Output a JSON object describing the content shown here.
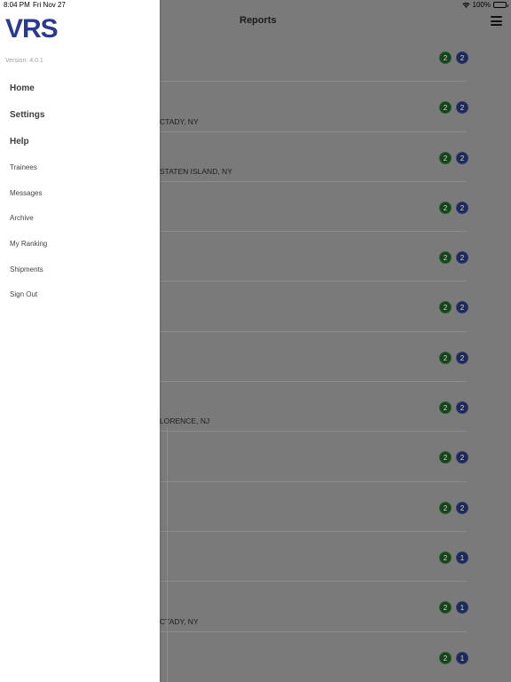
{
  "status_bar": {
    "time": "8:04 PM",
    "date": "Fri Nov 27",
    "battery": "100%",
    "icons": [
      "wifi-icon",
      "battery-icon"
    ]
  },
  "reports": {
    "title": "Reports",
    "menu_icon": "hamburger-menu-icon",
    "rows": [
      {
        "subtitle": "",
        "badge_green": "2",
        "badge_blue": "2"
      },
      {
        "subtitle": "CTADY, NY",
        "badge_green": "2",
        "badge_blue": "2"
      },
      {
        "subtitle": "STATEN ISLAND, NY",
        "badge_green": "2",
        "badge_blue": "2"
      },
      {
        "subtitle": "",
        "badge_green": "2",
        "badge_blue": "2"
      },
      {
        "subtitle": "",
        "badge_green": "2",
        "badge_blue": "2"
      },
      {
        "subtitle": "",
        "badge_green": "2",
        "badge_blue": "2"
      },
      {
        "subtitle": "",
        "badge_green": "2",
        "badge_blue": "2"
      },
      {
        "subtitle": "LORENCE, NJ",
        "badge_green": "2",
        "badge_blue": "2"
      },
      {
        "subtitle": "",
        "badge_green": "2",
        "badge_blue": "2"
      },
      {
        "subtitle": "",
        "badge_green": "2",
        "badge_blue": "2"
      },
      {
        "subtitle": "",
        "badge_green": "2",
        "badge_blue": "1"
      },
      {
        "subtitle": "CTADY, NY",
        "badge_green": "2",
        "badge_blue": "1"
      },
      {
        "subtitle": "",
        "badge_green": "2",
        "badge_blue": "1"
      }
    ],
    "colors": {
      "badge_green": "#17431a",
      "badge_blue": "#1e2a55",
      "overlay": "#7a7a7a"
    }
  },
  "drawer": {
    "logo": "VRS",
    "version": "Version: 4.0.1",
    "primary_items": [
      {
        "label": "Home"
      },
      {
        "label": "Settings"
      },
      {
        "label": "Help"
      }
    ],
    "secondary_items": [
      {
        "label": "Trainees"
      },
      {
        "label": "Messages"
      },
      {
        "label": "Archive"
      },
      {
        "label": "My Ranking"
      },
      {
        "label": "Shipments"
      },
      {
        "label": "Sign Out"
      }
    ],
    "colors": {
      "logo": "#2a3a8c"
    }
  }
}
